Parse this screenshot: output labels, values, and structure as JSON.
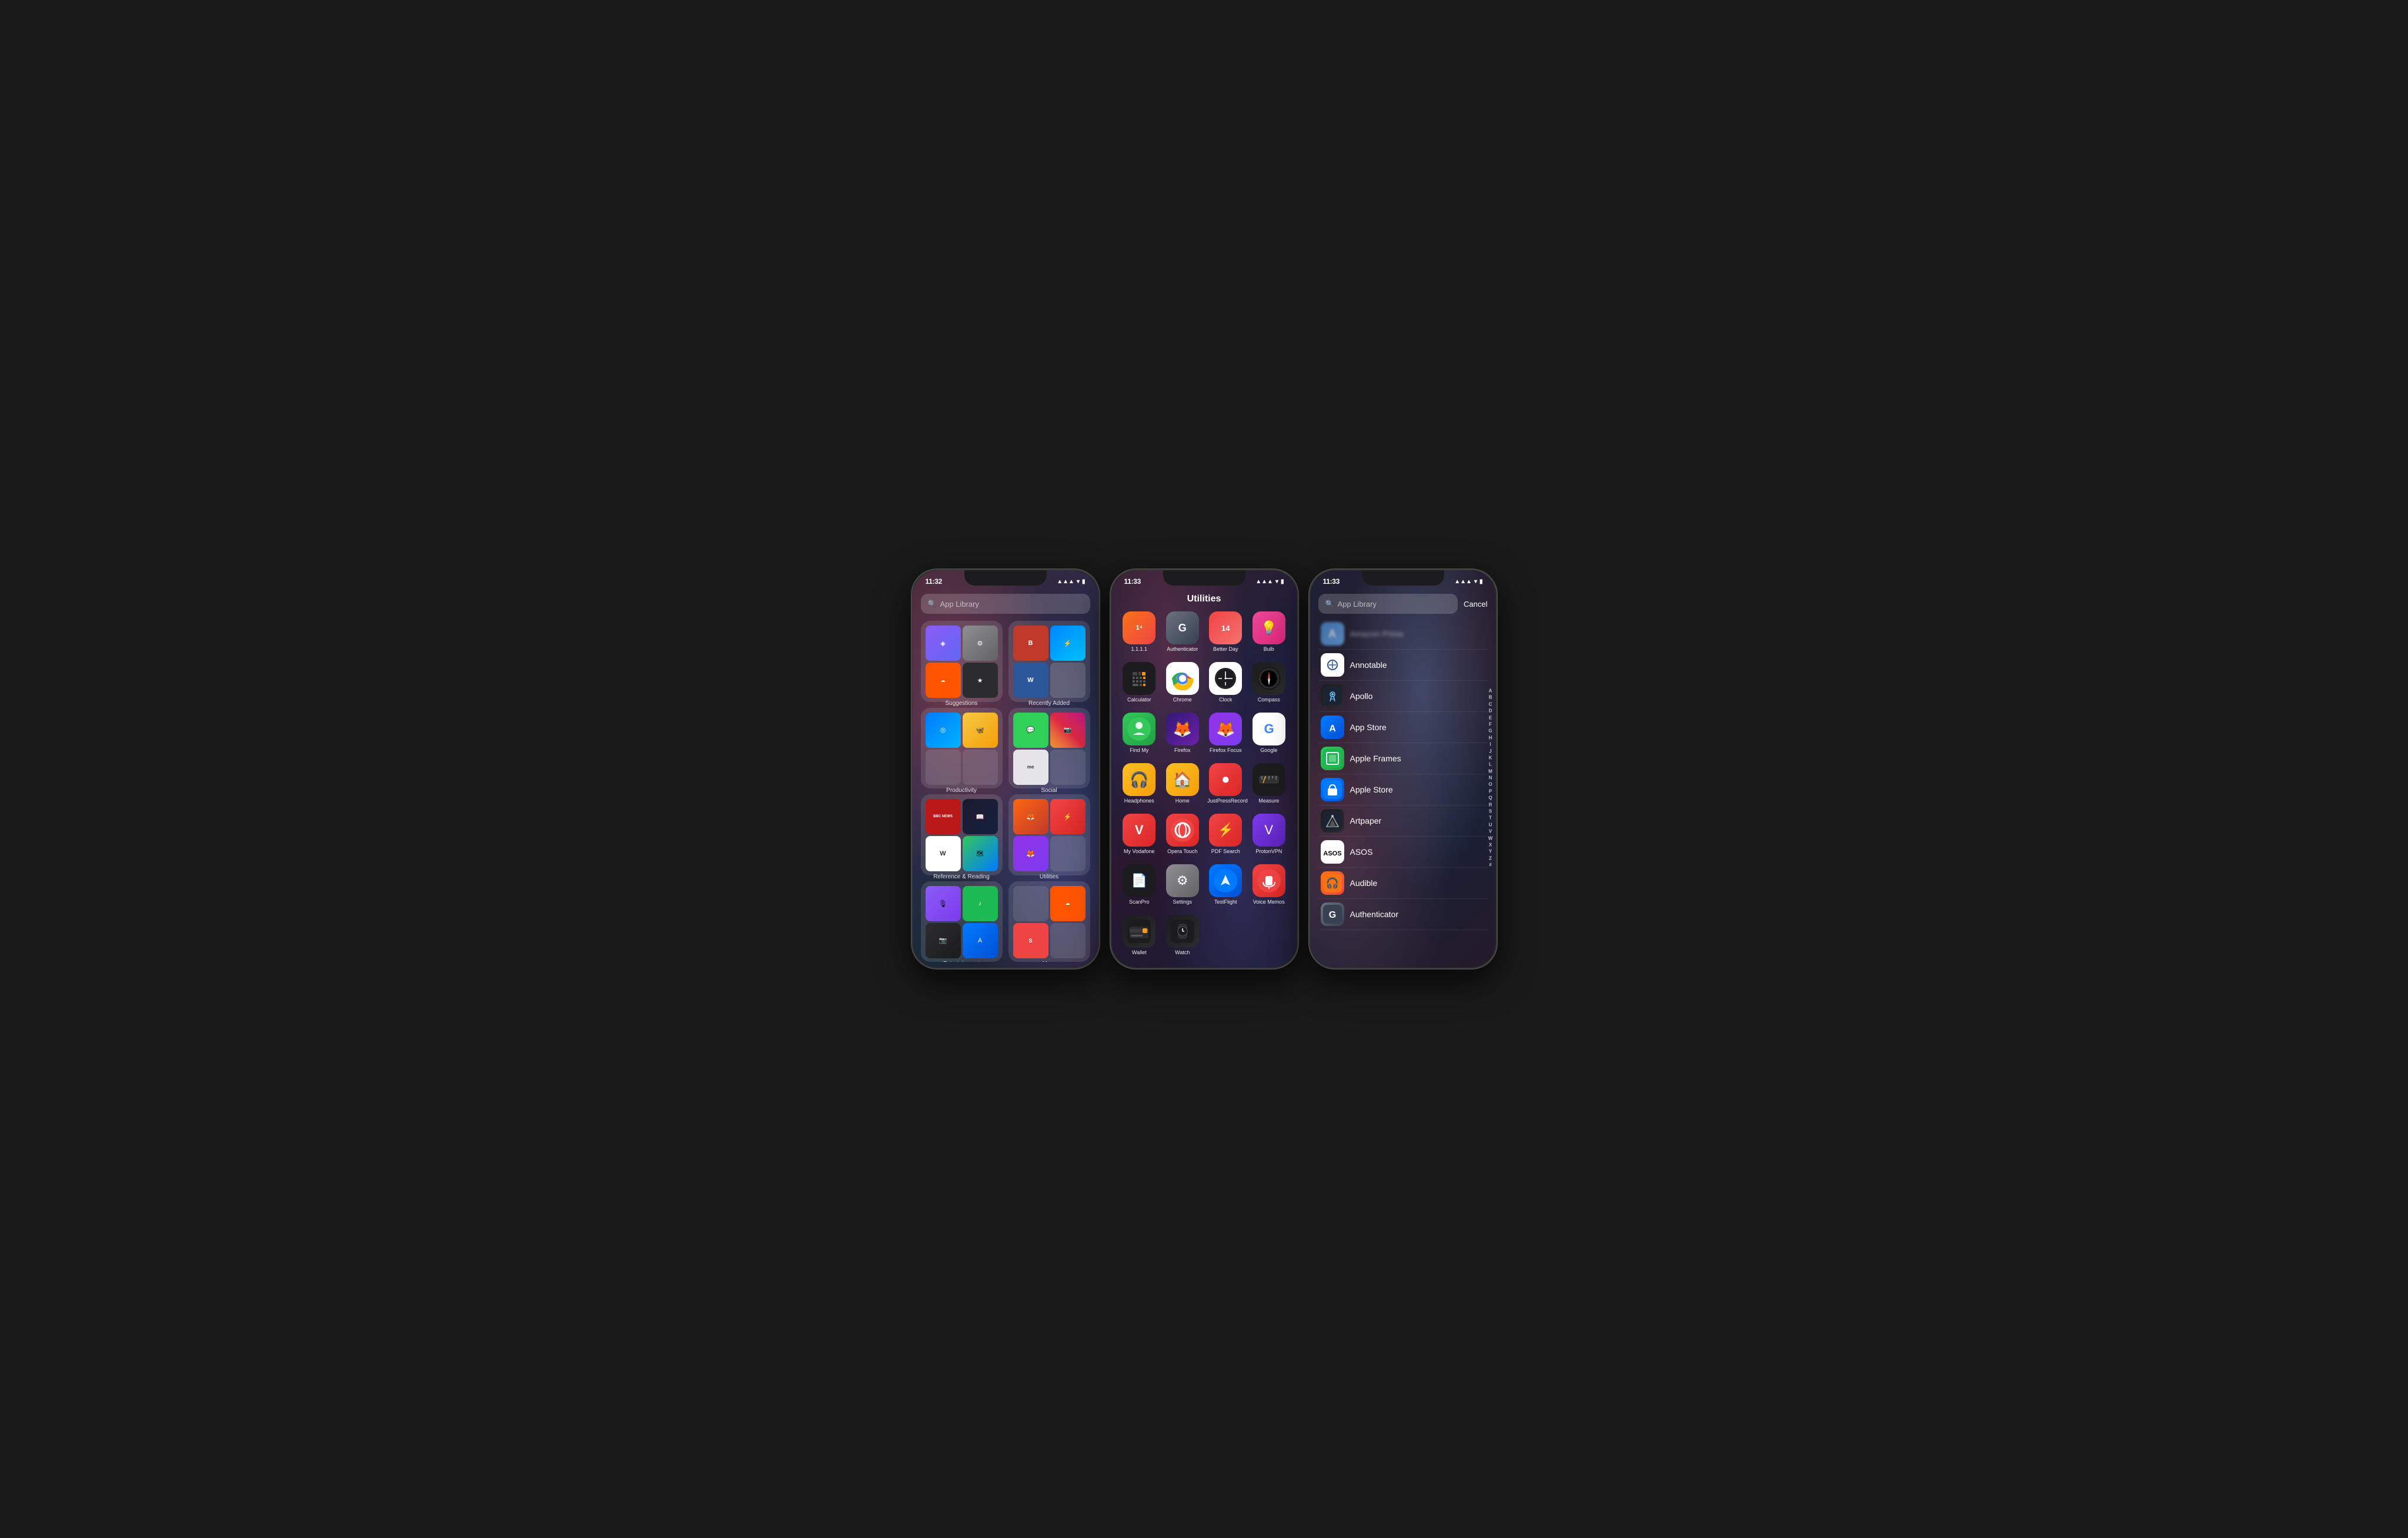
{
  "phone1": {
    "time": "11:32",
    "search_placeholder": "App Library",
    "folders": [
      {
        "name": "Suggestions",
        "icons": [
          {
            "color": "ic-shortcuts",
            "symbol": "◈"
          },
          {
            "color": "ic-settings",
            "symbol": "⚙"
          },
          {
            "color": "ic-soundcloud",
            "symbol": "☁"
          },
          {
            "color": "ic-star",
            "symbol": "★"
          }
        ]
      },
      {
        "name": "Recently Added",
        "icons": [
          {
            "color": "ic-bear",
            "symbol": "B"
          },
          {
            "color": "ic-messenger",
            "symbol": "m"
          },
          {
            "color": "ic-word",
            "symbol": "W"
          },
          {
            "color": "ic-mini",
            "symbol": "·"
          }
        ]
      },
      {
        "name": "Productivity",
        "icons": [
          {
            "color": "ic-safari",
            "symbol": "◎"
          },
          {
            "color": "ic-kami",
            "symbol": "🦋"
          },
          {
            "color": "ic-mini",
            "symbol": "·"
          },
          {
            "color": "ic-mini",
            "symbol": "·"
          }
        ]
      },
      {
        "name": "Social",
        "icons": [
          {
            "color": "ic-messages",
            "symbol": "💬"
          },
          {
            "color": "ic-instagram",
            "symbol": "📷"
          },
          {
            "color": "ic-mini",
            "symbol": "me"
          },
          {
            "color": "ic-mini",
            "symbol": "·"
          }
        ]
      },
      {
        "name": "Reference & Reading",
        "icons": [
          {
            "color": "ic-bbcnews",
            "symbol": "BBC"
          },
          {
            "color": "ic-kindle",
            "symbol": "📖"
          },
          {
            "color": "ic-wiki",
            "symbol": "W"
          },
          {
            "color": "ic-maps",
            "symbol": "🗺"
          }
        ]
      },
      {
        "name": "Utilities",
        "icons": [
          {
            "color": "ic-firefox",
            "symbol": "🦊"
          },
          {
            "color": "ic-reeder",
            "symbol": "⚡"
          },
          {
            "color": "ic-firefox",
            "symbol": "🦊"
          },
          {
            "color": "ic-mini",
            "symbol": "·"
          }
        ]
      },
      {
        "name": "Entertainment",
        "icons": [
          {
            "color": "ic-podcasts",
            "symbol": "🎙"
          },
          {
            "color": "ic-spotify",
            "symbol": "♪"
          },
          {
            "color": "ic-camera",
            "symbol": "📷"
          },
          {
            "color": "ic-appstore",
            "symbol": "A"
          }
        ]
      }
    ]
  },
  "phone2": {
    "time": "11:33",
    "title": "Utilities",
    "apps": [
      {
        "name": "1.1.1.1",
        "color": "ic-1111",
        "symbol": "1"
      },
      {
        "name": "Authenticator",
        "color": "ic-authenticator",
        "symbol": "G"
      },
      {
        "name": "Better Day",
        "color": "ic-betterday",
        "symbol": "14"
      },
      {
        "name": "Bulb",
        "color": "ic-bulb",
        "symbol": "💡"
      },
      {
        "name": "Calculator",
        "color": "ic-calculator",
        "symbol": "="
      },
      {
        "name": "Chrome",
        "color": "ic-chrome",
        "symbol": "⊙"
      },
      {
        "name": "Clock",
        "color": "ic-clock",
        "symbol": "🕐"
      },
      {
        "name": "Compass",
        "color": "ic-compass",
        "symbol": "◎"
      },
      {
        "name": "Find My",
        "color": "ic-findmy",
        "symbol": "◉"
      },
      {
        "name": "Firefox",
        "color": "ic-firefox2",
        "symbol": "🦊"
      },
      {
        "name": "Firefox Focus",
        "color": "ic-firefoxfocus",
        "symbol": "🦊"
      },
      {
        "name": "Google",
        "color": "ic-google",
        "symbol": "G"
      },
      {
        "name": "Headphones",
        "color": "ic-headphones",
        "symbol": "🎧"
      },
      {
        "name": "Home",
        "color": "ic-home",
        "symbol": "🏠"
      },
      {
        "name": "JustPressRecord",
        "color": "ic-justpress",
        "symbol": "⏺"
      },
      {
        "name": "Measure",
        "color": "ic-measure",
        "symbol": "📏"
      },
      {
        "name": "My Vodafone",
        "color": "ic-myvodafone",
        "symbol": "V"
      },
      {
        "name": "Opera Touch",
        "color": "ic-operatouch",
        "symbol": "O"
      },
      {
        "name": "PDF Search",
        "color": "ic-pdfsearch",
        "symbol": "⚡"
      },
      {
        "name": "ProtonVPN",
        "color": "ic-protonvpn",
        "symbol": "V"
      },
      {
        "name": "ScanPro",
        "color": "ic-scanpro",
        "symbol": "📄"
      },
      {
        "name": "Settings",
        "color": "ic-system-settings",
        "symbol": "⚙"
      },
      {
        "name": "TestFlight",
        "color": "ic-testflight",
        "symbol": "✈"
      },
      {
        "name": "Voice Memos",
        "color": "ic-voicememos",
        "symbol": "🎙"
      },
      {
        "name": "Wallet",
        "color": "ic-wallet",
        "symbol": "💳"
      },
      {
        "name": "Watch",
        "color": "ic-watch",
        "symbol": "⌚"
      }
    ]
  },
  "phone3": {
    "time": "11:33",
    "search_placeholder": "App Library",
    "cancel_label": "Cancel",
    "apps": [
      {
        "name": "Amazon",
        "color": "ic-list-amazon",
        "symbol": "A"
      },
      {
        "name": "Annotable",
        "color": "ic-list-annotable",
        "symbol": "✏"
      },
      {
        "name": "Apollo",
        "color": "ic-list-apollo",
        "symbol": "🤖"
      },
      {
        "name": "App Store",
        "color": "ic-list-appstore",
        "symbol": "A"
      },
      {
        "name": "Apple Frames",
        "color": "ic-list-appleframes",
        "symbol": "🖼"
      },
      {
        "name": "Apple Store",
        "color": "ic-list-applestore",
        "symbol": "🛍"
      },
      {
        "name": "Artpaper",
        "color": "ic-list-artpaper",
        "symbol": "🏔"
      },
      {
        "name": "ASOS",
        "color": "ic-list-asos",
        "symbol": "a"
      },
      {
        "name": "Audible",
        "color": "ic-list-audible",
        "symbol": "🎧"
      },
      {
        "name": "Authenticator",
        "color": "ic-list-authenticator",
        "symbol": "G"
      }
    ],
    "alphabet": [
      "A",
      "B",
      "C",
      "D",
      "E",
      "F",
      "G",
      "H",
      "I",
      "J",
      "K",
      "L",
      "M",
      "N",
      "O",
      "P",
      "Q",
      "R",
      "S",
      "T",
      "U",
      "V",
      "W",
      "X",
      "Y",
      "Z",
      "#"
    ]
  },
  "icons": {
    "search": "🔍",
    "signal": "▲▲▲",
    "wifi": "WiFi",
    "battery": "▮"
  }
}
